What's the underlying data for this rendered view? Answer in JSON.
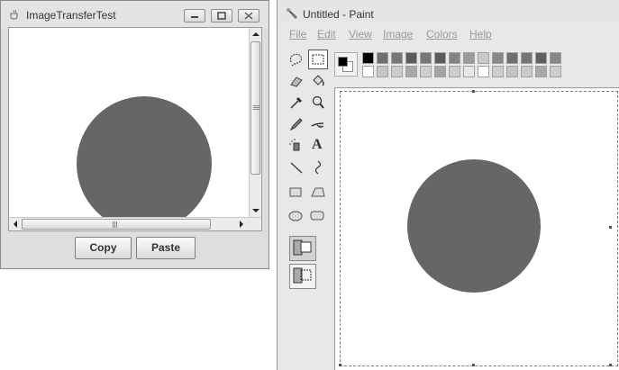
{
  "java_window": {
    "title": "ImageTransferTest",
    "buttons": {
      "copy": "Copy",
      "paste": "Paste"
    },
    "circle_color": "#666666"
  },
  "paint_window": {
    "title": "Untitled - Paint",
    "menu": [
      "File",
      "Edit",
      "View",
      "Image",
      "Colors",
      "Help"
    ],
    "tools": [
      "free-form-select",
      "rectangle-select",
      "eraser",
      "fill",
      "color-picker",
      "magnifier",
      "pencil",
      "brush",
      "airbrush",
      "text",
      "line",
      "curve",
      "rectangle",
      "polygon",
      "ellipse",
      "rounded-rectangle"
    ],
    "text_tool_glyph": "A",
    "foreground_color": "#000000",
    "background_color": "#ffffff",
    "palette_top": [
      "#000000",
      "#6e6e6e",
      "#777777",
      "#5c5c5c",
      "#777777",
      "#5a5a5a",
      "#838383",
      "#9b9b9b",
      "#c9c9c9",
      "#888888",
      "#6e6e6e",
      "#757575",
      "#5f5f5f",
      "#868686"
    ],
    "palette_bottom": [
      "#ffffff",
      "#c6c6c6",
      "#cccccc",
      "#a9a9a9",
      "#cfcfcf",
      "#a5a5a5",
      "#cdcdcd",
      "#e8e8e8",
      "#ffffff",
      "#cdcdcd",
      "#c3c3c3",
      "#cacaca",
      "#aaaaaa",
      "#cdcdcd"
    ],
    "circle_color": "#666666"
  }
}
